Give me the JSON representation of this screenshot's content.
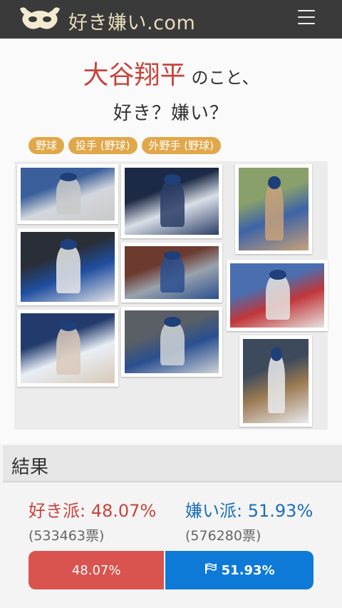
{
  "header": {
    "site_name": "好き嫌い.com",
    "logo_icon": "mask-icon",
    "menu_icon": "hamburger-menu-icon"
  },
  "topic": {
    "name": "大谷翔平",
    "suffix": "のこと、",
    "question": "好き？嫌い？"
  },
  "tags": [
    "野球",
    "投手 (野球)",
    "外野手 (野球)"
  ],
  "gallery": {
    "photos": [
      {
        "id": "p1",
        "colors": [
          "#3b5f9a",
          "#c9c9c9",
          "#d3d7dd"
        ]
      },
      {
        "id": "p2",
        "colors": [
          "#1d2a46",
          "#2b3d66",
          "#d9dfe8"
        ]
      },
      {
        "id": "p3",
        "colors": [
          "#8aa06a",
          "#c7a17a",
          "#3e63a6"
        ]
      },
      {
        "id": "p4",
        "colors": [
          "#2a2e36",
          "#e6e6e8",
          "#1f4ea0"
        ]
      },
      {
        "id": "p5",
        "colors": [
          "#6c3a2f",
          "#2a4f8f",
          "#9aa2ad"
        ]
      },
      {
        "id": "p6",
        "colors": [
          "#4a6fb0",
          "#e7e3e0",
          "#c0363a"
        ]
      },
      {
        "id": "p7",
        "colors": [
          "#223b6c",
          "#d9c9b8",
          "#e8eef5"
        ]
      },
      {
        "id": "p8",
        "colors": [
          "#5a5f66",
          "#cfd3d8",
          "#2a4f8f"
        ]
      },
      {
        "id": "p9",
        "colors": [
          "#3c4a5c",
          "#e9eaec",
          "#9b7a52"
        ]
      }
    ]
  },
  "result": {
    "heading": "結果",
    "like_label": "好き派:",
    "like_percent": "48.07%",
    "like_votes": "(533463票)",
    "dislike_label": "嫌い派:",
    "dislike_percent": "51.93%",
    "dislike_votes": "(576280票)",
    "bar_like_text": "48.07%",
    "bar_dislike_text": "51.93%",
    "bar_like_share": 48.07,
    "bar_dislike_share": 51.93,
    "bar_flag_icon": "flag-icon"
  },
  "colors": {
    "header_bg": "#3a3a3a",
    "like": "#d9534f",
    "dislike": "#0d7ad8",
    "tag": "#e0a84a",
    "title_name": "#c9443d"
  }
}
